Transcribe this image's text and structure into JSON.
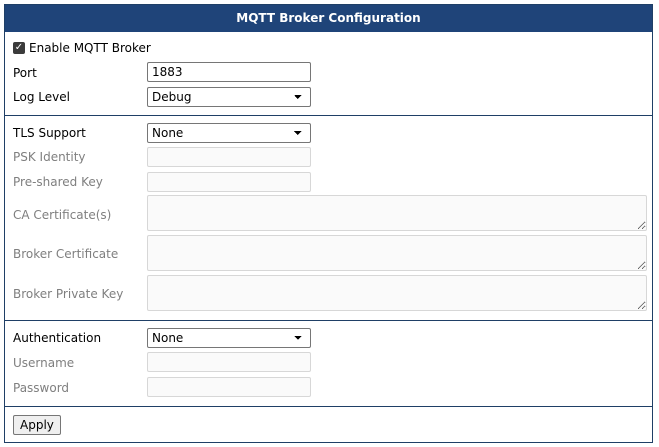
{
  "header": {
    "title": "MQTT Broker Configuration"
  },
  "general": {
    "enable_label": "Enable MQTT Broker",
    "enable_checked": true,
    "port_label": "Port",
    "port_value": "1883",
    "log_level_label": "Log Level",
    "log_level_value": "Debug"
  },
  "tls": {
    "label": "TLS Support",
    "value": "None",
    "psk_identity_label": "PSK Identity",
    "psk_identity_value": "",
    "pre_shared_key_label": "Pre-shared Key",
    "pre_shared_key_value": "",
    "ca_certificate_label": "CA Certificate(s)",
    "broker_certificate_label": "Broker Certificate",
    "broker_private_key_label": "Broker Private Key"
  },
  "auth": {
    "label": "Authentication",
    "value": "None",
    "username_label": "Username",
    "username_value": "",
    "password_label": "Password",
    "password_value": ""
  },
  "actions": {
    "apply_label": "Apply"
  },
  "colors": {
    "header_bg": "#1f4479",
    "border": "#1f3f66",
    "disabled_text": "#7f7f7f"
  }
}
